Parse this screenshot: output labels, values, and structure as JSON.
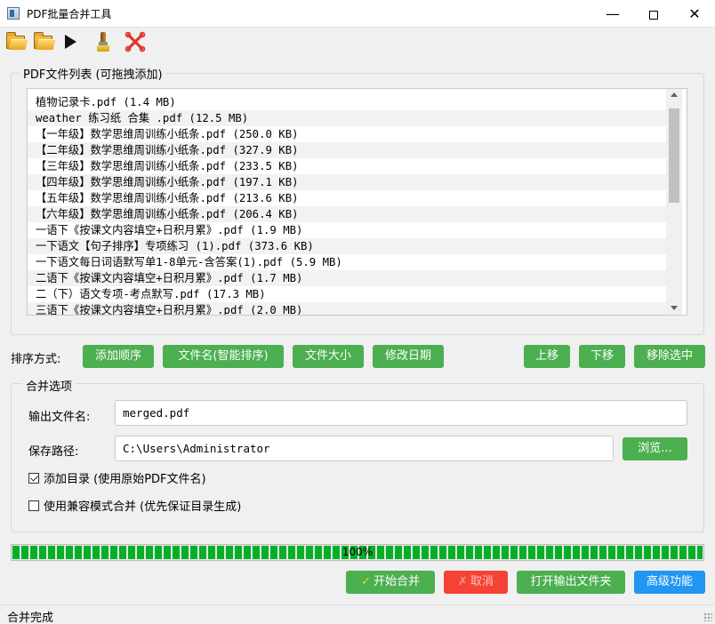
{
  "window": {
    "title": "PDF批量合并工具",
    "min": "—",
    "close": "✕"
  },
  "toolbar": {
    "icons": [
      "open-folder-icon",
      "add-folder-icon",
      "play-icon",
      "brush-icon",
      "clear-icon"
    ]
  },
  "file_list": {
    "title": "PDF文件列表 (可拖拽添加)",
    "items": [
      "植物记录卡.pdf (1.4 MB)",
      "weather 练习纸 合集 .pdf (12.5 MB)",
      "【一年级】数学思维周训练小纸条.pdf (250.0 KB)",
      "【二年级】数学思维周训练小纸条.pdf (327.9 KB)",
      "【三年级】数学思维周训练小纸条.pdf (233.5 KB)",
      "【四年级】数学思维周训练小纸条.pdf (197.1 KB)",
      "【五年级】数学思维周训练小纸条.pdf (213.6 KB)",
      "【六年级】数学思维周训练小纸条.pdf (206.4 KB)",
      "一语下《按课文内容填空+日积月累》.pdf (1.9 MB)",
      "一下语文【句子排序】专项练习 (1).pdf (373.6 KB)",
      "一下语文每日词语默写单1-8单元-含答案(1).pdf (5.9 MB)",
      "二语下《按课文内容填空+日积月累》.pdf (1.7 MB)",
      "二（下）语文专项-考点默写.pdf (17.3 MB)",
      "三语下《按课文内容填空+日积月累》.pdf (2.0 MB)"
    ]
  },
  "sort": {
    "label": "排序方式:",
    "add_order": "添加顺序",
    "by_name": "文件名(智能排序)",
    "by_size": "文件大小",
    "by_date": "修改日期",
    "move_up": "上移",
    "move_down": "下移",
    "remove": "移除选中"
  },
  "options": {
    "title": "合并选项",
    "output_label": "输出文件名:",
    "output_value": "merged.pdf",
    "path_label": "保存路径:",
    "path_value": "C:\\Users\\Administrator",
    "browse": "浏览...",
    "add_toc": "添加目录 (使用原始PDF文件名)",
    "add_toc_checked": true,
    "compat_mode": "使用兼容模式合并 (优先保证目录生成)",
    "compat_checked": false
  },
  "progress": {
    "value": 100,
    "text": "100%",
    "color": "#06b025"
  },
  "actions": {
    "start": "开始合并",
    "cancel": "取消",
    "open_folder": "打开输出文件夹",
    "advanced": "高级功能"
  },
  "status": {
    "text": "合并完成"
  },
  "colors": {
    "green": "#4caf50",
    "red": "#f44336",
    "blue": "#2196f3",
    "progress": "#06b025"
  }
}
